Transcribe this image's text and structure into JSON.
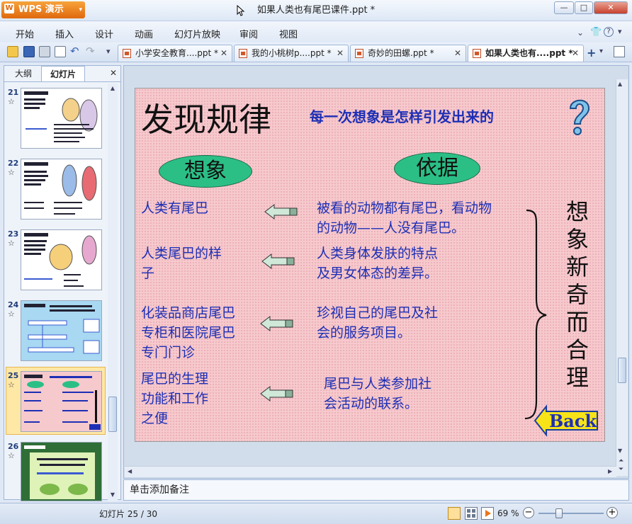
{
  "app": {
    "logo_text": "WPS 演示",
    "window_title": "如果人类也有尾巴课件.ppt *"
  },
  "window_controls": {
    "minimize": "—",
    "maximize": "□",
    "close": "✕"
  },
  "menu": [
    "开始",
    "插入",
    "设计",
    "动画",
    "幻灯片放映",
    "审阅",
    "视图"
  ],
  "toolbar": {
    "icons": [
      "open-folder-icon",
      "save-icon",
      "print-icon",
      "print-preview-icon",
      "undo-icon",
      "redo-icon",
      "dropdown-icon"
    ]
  },
  "tabs": [
    {
      "label": "小学安全教育....ppt *",
      "active": false
    },
    {
      "label": "我的小桃树p....ppt *",
      "active": false
    },
    {
      "label": "奇妙的田螺.ppt *",
      "active": false
    },
    {
      "label": "如果人类也有....ppt *",
      "active": true
    }
  ],
  "left_panel": {
    "tab_outline": "大纲",
    "tab_slides": "幻灯片",
    "close": "✕",
    "thumbnails": [
      {
        "number": "21",
        "star": "☆"
      },
      {
        "number": "22",
        "star": "☆"
      },
      {
        "number": "23",
        "star": "☆"
      },
      {
        "number": "24",
        "star": "☆"
      },
      {
        "number": "25",
        "star": "☆"
      },
      {
        "number": "26",
        "star": "☆"
      }
    ]
  },
  "slide": {
    "title": "发现规律",
    "subtitle": "每一次想象是怎样引发出来的",
    "col_left_header": "想象",
    "col_right_header": "依据",
    "rows": [
      {
        "left": [
          "人类有尾巴"
        ],
        "right": [
          "被看的动物都有尾巴，看动物",
          "的动物——人没有尾巴。"
        ]
      },
      {
        "left": [
          "人类尾巴的样",
          "子"
        ],
        "right": [
          "人类身体发肤的特点",
          "及男女体态的差异。"
        ]
      },
      {
        "left": [
          "化装品商店尾巴",
          "专柜和医院尾巴",
          "专门门诊"
        ],
        "right": [
          "珍视自己的尾巴及社",
          "会的服务项目。"
        ]
      },
      {
        "left": [
          "尾巴的生理",
          "功能和工作",
          "之便"
        ],
        "right": [
          "尾巴与人类参加社",
          "会活动的联系。"
        ]
      }
    ],
    "vertical_text": [
      "想",
      "象",
      "新",
      "奇",
      "而",
      "合",
      "理"
    ],
    "back_label": "Back",
    "question_mark": "?"
  },
  "notes_placeholder": "单击添加备注",
  "status": {
    "slide_counter": "幻灯片 25 / 30",
    "zoom": "69 %"
  },
  "colors": {
    "slide_bg": "#f6c9cd",
    "slide_text_blue": "#1d2fb5",
    "oval_green": "#2bbf86",
    "wps_orange": "#e97b1c"
  }
}
